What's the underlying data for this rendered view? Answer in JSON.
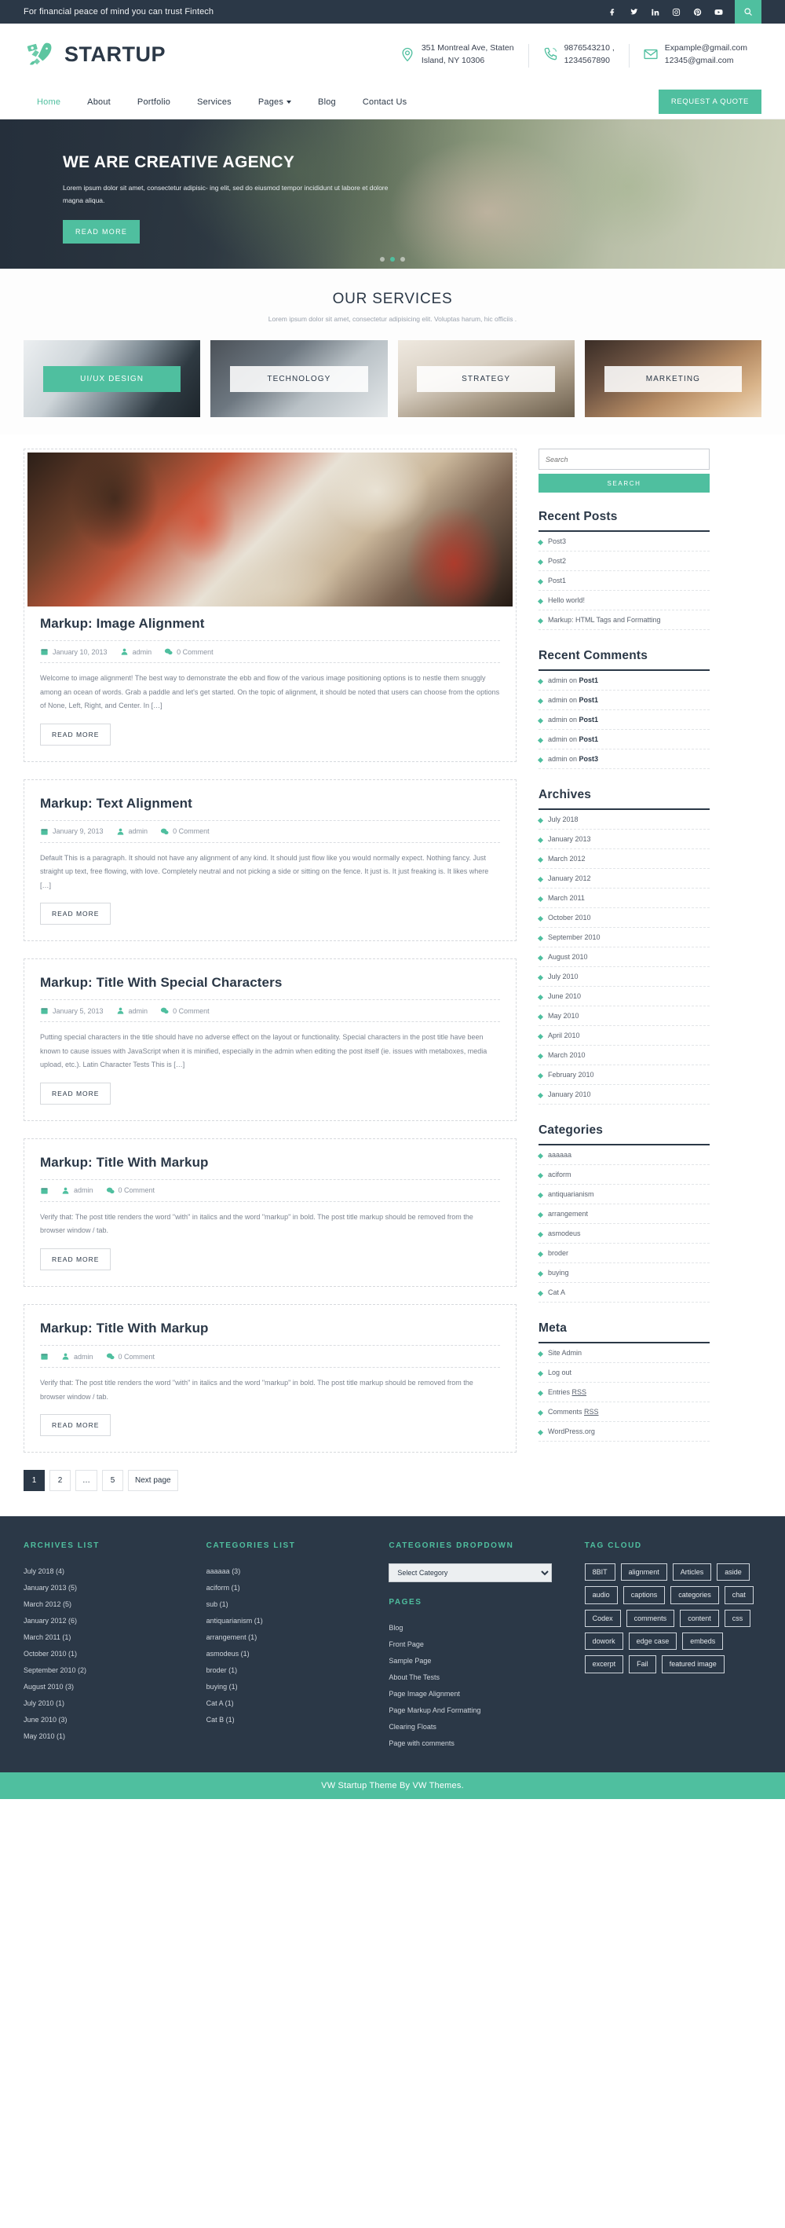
{
  "topbar": {
    "text": "For financial peace of mind you can trust Fintech",
    "socials": [
      {
        "name": "facebook-icon",
        "glyph": "f"
      },
      {
        "name": "twitter-icon",
        "glyph": "t"
      },
      {
        "name": "linkedin-icon",
        "glyph": "in"
      },
      {
        "name": "instagram-icon",
        "glyph": "ig"
      },
      {
        "name": "pinterest-icon",
        "glyph": "p"
      },
      {
        "name": "youtube-icon",
        "glyph": "▶"
      }
    ],
    "search_icon": "search-icon"
  },
  "header": {
    "brand": "STARTUP",
    "contacts": [
      {
        "icon": "location-pin-icon",
        "line1": "351 Montreal Ave, Staten",
        "line2": "Island, NY 10306"
      },
      {
        "icon": "phone-icon",
        "line1": "9876543210 ,",
        "line2": "1234567890"
      },
      {
        "icon": "envelope-icon",
        "line1": "Expample@gmail.com",
        "line2": "12345@gmail.com"
      }
    ]
  },
  "nav": {
    "items": [
      {
        "label": "Home",
        "active": true,
        "caret": false
      },
      {
        "label": "About",
        "active": false,
        "caret": false
      },
      {
        "label": "Portfolio",
        "active": false,
        "caret": false
      },
      {
        "label": "Services",
        "active": false,
        "caret": false
      },
      {
        "label": "Pages",
        "active": false,
        "caret": true
      },
      {
        "label": "Blog",
        "active": false,
        "caret": false
      },
      {
        "label": "Contact Us",
        "active": false,
        "caret": false
      }
    ],
    "quote_button": "REQUEST A QUOTE"
  },
  "hero": {
    "title": "WE ARE CREATIVE AGENCY",
    "subtitle": "Lorem ipsum dolor sit amet, consectetur adipisic- ing elit, sed do eiusmod tempor incididunt ut labore et dolore magna aliqua.",
    "button": "READ MORE",
    "slide_count": 3,
    "active_slide": 1
  },
  "services": {
    "title": "OUR SERVICES",
    "subtitle": "Lorem ipsum dolor sit amet, consectetur adipisicing elit. Voluptas harum, hic officiis .",
    "cards": [
      {
        "label": "UI/UX DESIGN",
        "active": true
      },
      {
        "label": "TECHNOLOGY",
        "active": false
      },
      {
        "label": "STRATEGY",
        "active": false
      },
      {
        "label": "MARKETING",
        "active": false
      }
    ]
  },
  "posts": [
    {
      "title": "Markup: Image Alignment",
      "has_thumb": true,
      "date": "January 10, 2013",
      "author": "admin",
      "comments": "0 Comment",
      "excerpt": "Welcome to image alignment! The best way to demonstrate the ebb and flow of the various image positioning options is to nestle them snuggly among an ocean of words. Grab a paddle and let's get started. On the topic of alignment, it should be noted that users can choose from the options of None, Left, Right, and Center. In […]",
      "read_more": "READ MORE"
    },
    {
      "title": "Markup: Text Alignment",
      "has_thumb": false,
      "date": "January 9, 2013",
      "author": "admin",
      "comments": "0 Comment",
      "excerpt": "Default This is a paragraph. It should not have any alignment of any kind. It should just flow like you would normally expect. Nothing fancy. Just straight up text, free flowing, with love. Completely neutral and not picking a side or sitting on the fence. It just is. It just freaking is. It likes where […]",
      "read_more": "READ MORE"
    },
    {
      "title": "Markup: Title With Special Characters",
      "has_thumb": false,
      "date": "January 5, 2013",
      "author": "admin",
      "comments": "0 Comment",
      "excerpt": "Putting special characters in the title should have no adverse effect on the layout or functionality. Special characters in the post title have been known to cause issues with JavaScript when it is minified, especially in the admin when editing the post itself (ie. issues with metaboxes, media upload, etc.). Latin Character Tests This is […]",
      "read_more": "READ MORE"
    },
    {
      "title": "Markup: Title With Markup",
      "has_thumb": false,
      "date": "",
      "author": "admin",
      "comments": "0 Comment",
      "excerpt": "Verify that: The post title renders the word \"with\" in italics and the word \"markup\" in bold. The post title markup should be removed from the browser window / tab.",
      "read_more": "READ MORE"
    },
    {
      "title": "Markup: Title With Markup",
      "has_thumb": false,
      "date": "",
      "author": "admin",
      "comments": "0 Comment",
      "excerpt": "Verify that: The post title renders the word \"with\" in italics and the word \"markup\" in bold. The post title markup should be removed from the browser window / tab.",
      "read_more": "READ MORE"
    }
  ],
  "pagination": [
    {
      "label": "1",
      "active": true
    },
    {
      "label": "2",
      "active": false
    },
    {
      "label": "…",
      "active": false
    },
    {
      "label": "5",
      "active": false
    },
    {
      "label": "Next page",
      "active": false
    }
  ],
  "sidebar": {
    "search_placeholder": "Search",
    "search_button": "SEARCH",
    "recent_posts": {
      "title": "Recent Posts",
      "items": [
        "Post3",
        "Post2",
        "Post1",
        "Hello world!",
        "Markup: HTML Tags and Formatting"
      ]
    },
    "recent_comments": {
      "title": "Recent Comments",
      "items": [
        {
          "author": "admin",
          "on": "on",
          "post": "Post1"
        },
        {
          "author": "admin",
          "on": "on",
          "post": "Post1"
        },
        {
          "author": "admin",
          "on": "on",
          "post": "Post1"
        },
        {
          "author": "admin",
          "on": "on",
          "post": "Post1"
        },
        {
          "author": "admin",
          "on": "on",
          "post": "Post3"
        }
      ]
    },
    "archives": {
      "title": "Archives",
      "items": [
        "July 2018",
        "January 2013",
        "March 2012",
        "January 2012",
        "March 2011",
        "October 2010",
        "September 2010",
        "August 2010",
        "July 2010",
        "June 2010",
        "May 2010",
        "April 2010",
        "March 2010",
        "February 2010",
        "January 2010"
      ]
    },
    "categories": {
      "title": "Categories",
      "items": [
        "aaaaaa",
        "aciform",
        "antiquarianism",
        "arrangement",
        "asmodeus",
        "broder",
        "buying",
        "Cat A"
      ]
    },
    "meta": {
      "title": "Meta",
      "items": [
        "Site Admin",
        "Log out",
        "Entries RSS",
        "Comments RSS",
        "WordPress.org"
      ]
    }
  },
  "footer": {
    "archives": {
      "title": "ARCHIVES LIST",
      "items": [
        "July 2018 (4)",
        "January 2013 (5)",
        "March 2012 (5)",
        "January 2012 (6)",
        "March 2011 (1)",
        "October 2010 (1)",
        "September 2010 (2)",
        "August 2010 (3)",
        "July 2010 (1)",
        "June 2010 (3)",
        "May 2010 (1)"
      ]
    },
    "categories": {
      "title": "CATEGORIES LIST",
      "items": [
        "aaaaaa (3)",
        "aciform (1)",
        "sub (1)",
        "antiquarianism (1)",
        "arrangement (1)",
        "asmodeus (1)",
        "broder (1)",
        "buying (1)",
        "Cat A (1)",
        "Cat B (1)"
      ]
    },
    "dropdown": {
      "title": "CATEGORIES DROPDOWN",
      "selected": "Select Category"
    },
    "pages": {
      "title": "PAGES",
      "items": [
        "Blog",
        "Front Page",
        "Sample Page",
        "About The Tests",
        "Page Image Alignment",
        "Page Markup And Formatting",
        "Clearing Floats",
        "Page with comments"
      ]
    },
    "tagcloud": {
      "title": "TAG CLOUD",
      "tags": [
        "8BIT",
        "alignment",
        "Articles",
        "aside",
        "audio",
        "captions",
        "categories",
        "chat",
        "Codex",
        "comments",
        "content",
        "css",
        "dowork",
        "edge case",
        "embeds",
        "excerpt",
        "Fail",
        "featured image"
      ]
    },
    "copyright": "VW Startup Theme By VW Themes."
  },
  "colors": {
    "accent": "#4fbf9f",
    "dark": "#2b3847"
  }
}
